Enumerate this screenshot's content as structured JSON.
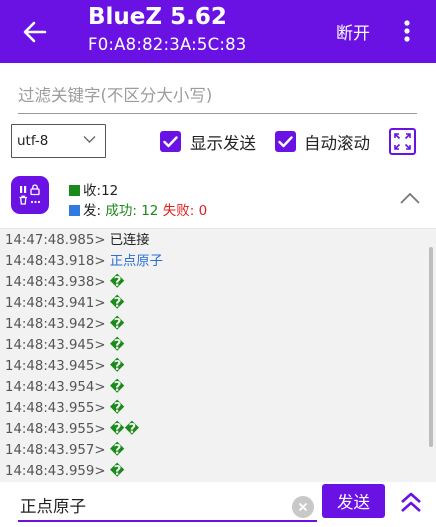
{
  "header": {
    "title": "BlueZ 5.62",
    "subtitle": "F0:A8:82:3A:5C:83",
    "disconnect_label": "断开",
    "back_icon": "arrow-left-icon",
    "more_icon": "more-vertical-icon"
  },
  "filter": {
    "value": "",
    "placeholder": "过滤关键字(不区分大小写)"
  },
  "controls": {
    "encoding": "utf-8",
    "show_sent_label": "显示发送",
    "show_sent_checked": true,
    "auto_scroll_label": "自动滚动",
    "auto_scroll_checked": true,
    "fullscreen_icon": "fullscreen-icon"
  },
  "stats": {
    "recv_label": "收:",
    "recv_count": "12",
    "sent_label": "发:",
    "success_label": "成功:",
    "success_count": "12",
    "fail_label": "失败:",
    "fail_count": "0",
    "recv_color": "#1a8a1a",
    "sent_color": "#2f7be0",
    "fail_color": "#e02020"
  },
  "log": [
    {
      "time": "14:47:48.985>",
      "text": "已连接",
      "kind": "status"
    },
    {
      "time": "14:48:43.918>",
      "text": "正点原子",
      "kind": "sent"
    },
    {
      "time": "14:48:43.938>",
      "text": "�",
      "kind": "recv"
    },
    {
      "time": "14:48:43.941>",
      "text": "�",
      "kind": "recv"
    },
    {
      "time": "14:48:43.942>",
      "text": "�",
      "kind": "recv"
    },
    {
      "time": "14:48:43.945>",
      "text": "�",
      "kind": "recv"
    },
    {
      "time": "14:48:43.945>",
      "text": "�",
      "kind": "recv"
    },
    {
      "time": "14:48:43.954>",
      "text": "�",
      "kind": "recv"
    },
    {
      "time": "14:48:43.955>",
      "text": "�",
      "kind": "recv"
    },
    {
      "time": "14:48:43.955>",
      "text": "��",
      "kind": "recv"
    },
    {
      "time": "14:48:43.957>",
      "text": "�",
      "kind": "recv"
    },
    {
      "time": "14:48:43.959>",
      "text": "�",
      "kind": "recv"
    }
  ],
  "send": {
    "value": "正点原子",
    "button_label": "发送"
  },
  "colors": {
    "accent": "#6a12e4"
  }
}
